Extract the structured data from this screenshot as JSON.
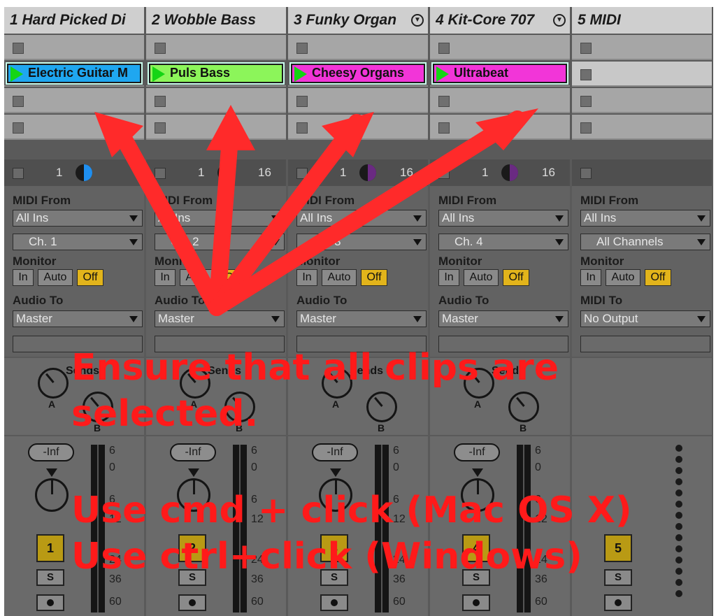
{
  "tracks": [
    {
      "name": "1 Hard Picked Di",
      "fold": false,
      "clip": {
        "label": "Electric Guitar M",
        "color": "#1fa7f0"
      },
      "io": {
        "num_left": "1",
        "num_right": "",
        "knob_color": "#1f8ff0",
        "midi_from": "All Ins",
        "channel": "Ch. 1",
        "monitor": [
          "In",
          "Auto",
          "Off"
        ],
        "audio_label": "Audio To",
        "audio_to": "Master"
      },
      "mixer": {
        "vol": "-Inf",
        "button": "1",
        "solo": "S",
        "scale": [
          "6",
          "0",
          "6",
          "12",
          "24",
          "36",
          "60"
        ]
      }
    },
    {
      "name": "2 Wobble Bass",
      "fold": false,
      "clip": {
        "label": "Puls Bass",
        "color": "#8cf55a"
      },
      "io": {
        "num_left": "1",
        "num_right": "16",
        "knob_color": "#5b2a72",
        "midi_from": "All Ins",
        "channel": "Ch. 2",
        "monitor": [
          "In",
          "Auto",
          "Off"
        ],
        "audio_label": "Audio To",
        "audio_to": "Master"
      },
      "mixer": {
        "vol": "-Inf",
        "button": "2",
        "solo": "S",
        "scale": [
          "6",
          "0",
          "6",
          "12",
          "24",
          "36",
          "60"
        ]
      }
    },
    {
      "name": "3 Funky Organ",
      "fold": true,
      "clip": {
        "label": "Cheesy Organs",
        "color": "#f235d8"
      },
      "io": {
        "num_left": "1",
        "num_right": "16",
        "knob_color": "#6a2a82",
        "midi_from": "All Ins",
        "channel": "Ch. 3",
        "monitor": [
          "In",
          "Auto",
          "Off"
        ],
        "audio_label": "Audio To",
        "audio_to": "Master"
      },
      "mixer": {
        "vol": "-Inf",
        "button": "3",
        "solo": "S",
        "scale": [
          "6",
          "0",
          "6",
          "12",
          "24",
          "36",
          "60"
        ]
      }
    },
    {
      "name": "4 Kit-Core 707",
      "fold": true,
      "clip": {
        "label": "Ultrabeat",
        "color": "#f235d8"
      },
      "io": {
        "num_left": "1",
        "num_right": "16",
        "knob_color": "#6a2a82",
        "midi_from": "All Ins",
        "channel": "Ch. 4",
        "monitor": [
          "In",
          "Auto",
          "Off"
        ],
        "audio_label": "Audio To",
        "audio_to": "Master"
      },
      "mixer": {
        "vol": "-Inf",
        "button": "4",
        "solo": "S",
        "scale": [
          "6",
          "0",
          "6",
          "12",
          "24",
          "36",
          "60"
        ]
      }
    },
    {
      "name": "5 MIDI",
      "fold": false,
      "clip": null,
      "io": {
        "num_left": "",
        "num_right": "",
        "knob_color": "",
        "midi_from": "All Ins",
        "channel": "All Channels",
        "monitor": [
          "In",
          "Auto",
          "Off"
        ],
        "audio_label": "MIDI To",
        "audio_to": "No Output"
      },
      "mixer": {
        "vol": "",
        "button": "5",
        "solo": "S",
        "scale": []
      }
    }
  ],
  "labels": {
    "midi_from": "MIDI From",
    "monitor": "Monitor",
    "sends": "Sends",
    "send_a": "A",
    "send_b": "B"
  },
  "annotation": {
    "line1": "Ensure that all clips are",
    "line2": "selected.",
    "line3": "Use cmd + click (Mac OS X)",
    "line4": "Use ctrl+click (Windows)"
  },
  "colors": {
    "accent_red": "#ff1a1a",
    "clip_play": "#15d515",
    "monitor_off": "#e2b41b",
    "track_button": "#b99a14"
  }
}
